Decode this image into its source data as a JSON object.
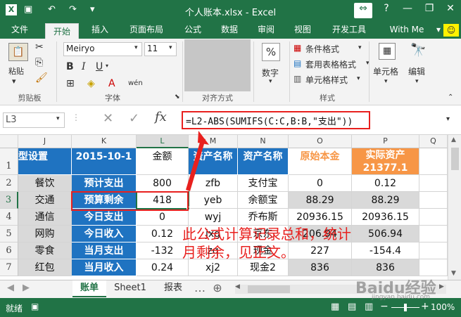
{
  "window": {
    "title": "个人账本.xlsx - Excel",
    "help": "?",
    "minimize": "—",
    "close": "✕"
  },
  "tabs": [
    "文件",
    "开始",
    "插入",
    "页面布局",
    "公式",
    "数据",
    "审阅",
    "视图",
    "开发工具"
  ],
  "user": "With Me",
  "ribbon": {
    "paste": "粘贴",
    "clipboard": "剪贴板",
    "font_name": "Meiryo",
    "font_size": "11",
    "font_group": "字体",
    "bold": "B",
    "italic": "I",
    "underline": "U",
    "wen": "wén",
    "align_group": "对齐方式",
    "number": "数字",
    "cond_format": "条件格式",
    "table_format": "套用表格格式",
    "cell_style": "单元格样式",
    "style_group": "样式",
    "cells": "单元格",
    "edit": "编辑"
  },
  "formula_bar": {
    "name_box": "L3",
    "fx": "fx",
    "formula": "=L2-ABS(SUMIFS(C:C,B:B,\"支出\"))"
  },
  "columns": [
    "J",
    "K",
    "L",
    "M",
    "N",
    "O",
    "P",
    "Q"
  ],
  "rows": [
    "1",
    "2",
    "3",
    "4",
    "5",
    "6",
    "7"
  ],
  "cells": {
    "j": [
      "型设置",
      "餐饮",
      "交通",
      "通信",
      "网购",
      "零食",
      "红包"
    ],
    "k": [
      "2015-10-1",
      "预计支出",
      "预算剩余",
      "今日支出",
      "今日收入",
      "当月支出",
      "当月收入"
    ],
    "l": [
      "金额",
      "800",
      "418",
      "0",
      "0.12",
      "-132",
      "0.24"
    ],
    "m": [
      "资产名称",
      "zfb",
      "yeb",
      "wyj",
      "jxg",
      "zq",
      "xj2"
    ],
    "n": [
      "资产名称",
      "支付宝",
      "余额宝",
      "乔布斯",
      "京东",
      "现金",
      "现金2"
    ],
    "o": [
      "原始本金",
      "0",
      "88.29",
      "20936.15",
      "206.94",
      "227",
      "836"
    ],
    "p_head1": "实际资产",
    "p_head2": "21377.1",
    "p": [
      "0.12",
      "88.29",
      "20936.15",
      "506.94",
      "-154.4",
      "836"
    ]
  },
  "annotation": "此公式计算记录总和，统计月剩余，见正文。",
  "sheets": [
    "账单",
    "Sheet1",
    "报表"
  ],
  "status": {
    "ready": "就绪",
    "zoom": "100%"
  },
  "watermark": "Baidu经验",
  "watermark_url": "jingyan.baidu.com",
  "colors": {
    "excel_green": "#217346",
    "blue": "#1f73c1",
    "orange": "#f79646",
    "red": "#e8201e"
  }
}
